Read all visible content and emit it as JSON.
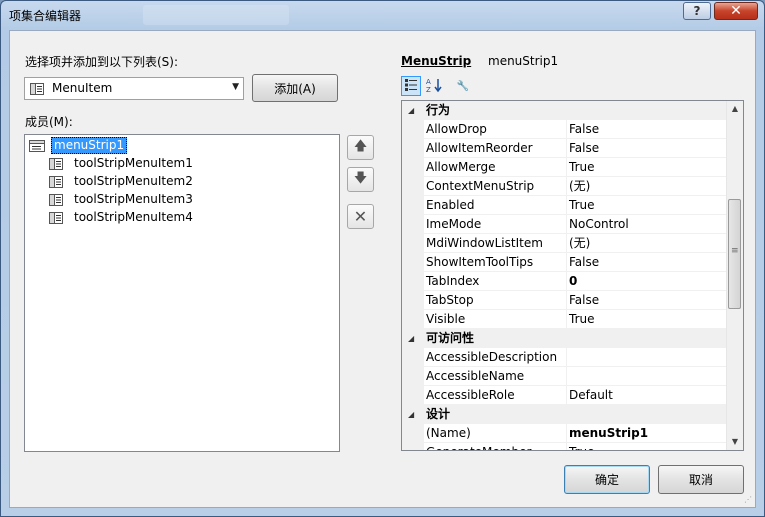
{
  "window": {
    "title": "项集合编辑器",
    "help_label": "?",
    "close_label": "✕"
  },
  "left": {
    "select_label": "选择项并添加到以下列表(S):",
    "combo_value": "MenuItem",
    "add_button": "添加(A)",
    "members_label": "成员(M):",
    "members": [
      {
        "label": "menuStrip1",
        "selected": true,
        "indent": 0
      },
      {
        "label": "toolStripMenuItem1",
        "selected": false,
        "indent": 1
      },
      {
        "label": "toolStripMenuItem2",
        "selected": false,
        "indent": 1
      },
      {
        "label": "toolStripMenuItem3",
        "selected": false,
        "indent": 1
      },
      {
        "label": "toolStripMenuItem4",
        "selected": false,
        "indent": 1
      }
    ]
  },
  "right": {
    "object_type": "MenuStrip",
    "object_name": "menuStrip1",
    "rows": [
      {
        "type": "category",
        "name": "行为"
      },
      {
        "type": "prop",
        "name": "AllowDrop",
        "value": "False",
        "bold": false
      },
      {
        "type": "prop",
        "name": "AllowItemReorder",
        "value": "False",
        "bold": false
      },
      {
        "type": "prop",
        "name": "AllowMerge",
        "value": "True",
        "bold": false
      },
      {
        "type": "prop",
        "name": "ContextMenuStrip",
        "value": "(无)",
        "bold": false
      },
      {
        "type": "prop",
        "name": "Enabled",
        "value": "True",
        "bold": false
      },
      {
        "type": "prop",
        "name": "ImeMode",
        "value": "NoControl",
        "bold": false
      },
      {
        "type": "prop",
        "name": "MdiWindowListItem",
        "value": "(无)",
        "bold": false
      },
      {
        "type": "prop",
        "name": "ShowItemToolTips",
        "value": "False",
        "bold": false
      },
      {
        "type": "prop",
        "name": "TabIndex",
        "value": "0",
        "bold": true
      },
      {
        "type": "prop",
        "name": "TabStop",
        "value": "False",
        "bold": false
      },
      {
        "type": "prop",
        "name": "Visible",
        "value": "True",
        "bold": false
      },
      {
        "type": "category",
        "name": "可访问性"
      },
      {
        "type": "prop",
        "name": "AccessibleDescription",
        "value": "",
        "bold": false
      },
      {
        "type": "prop",
        "name": "AccessibleName",
        "value": "",
        "bold": false
      },
      {
        "type": "prop",
        "name": "AccessibleRole",
        "value": "Default",
        "bold": false
      },
      {
        "type": "category",
        "name": "设计"
      },
      {
        "type": "prop",
        "name": "(Name)",
        "value": "menuStrip1",
        "bold": true
      },
      {
        "type": "prop",
        "name": "GenerateMember",
        "value": "True",
        "bold": false
      }
    ]
  },
  "buttons": {
    "ok": "确定",
    "cancel": "取消"
  }
}
